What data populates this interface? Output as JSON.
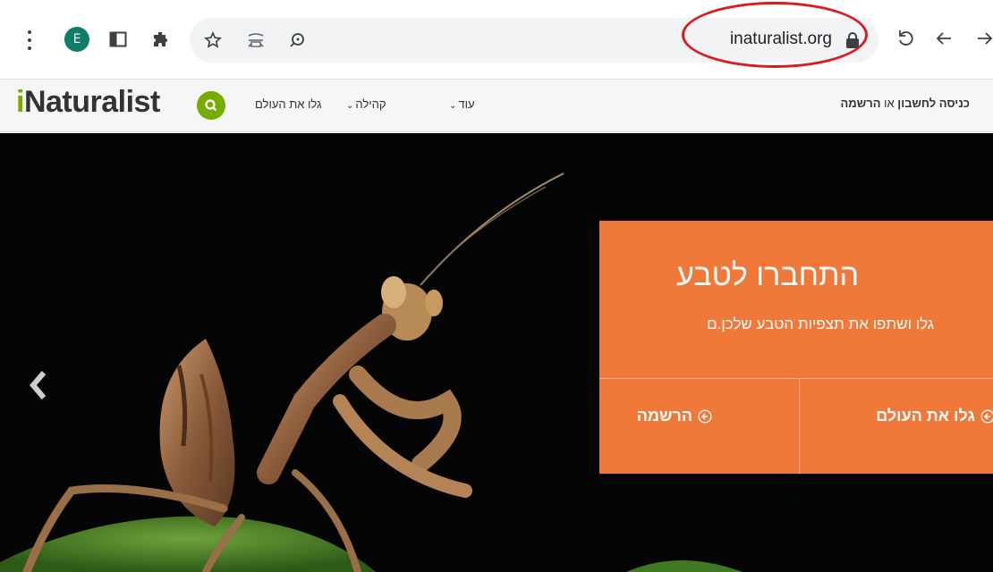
{
  "browser": {
    "profile_initial": "E",
    "url": "inaturalist.org",
    "icons": [
      "menu-icon",
      "sidebar-icon",
      "extensions-icon",
      "star-icon",
      "cast-icon",
      "lens-icon",
      "lock-icon",
      "reload-icon",
      "back-icon",
      "forward-icon"
    ]
  },
  "header": {
    "logo_prefix": "i",
    "logo_rest": "Naturalist",
    "nav": {
      "explore": "גלו את העולם",
      "community": "קהילה",
      "more": "עוד"
    },
    "login": "כניסה לחשבון",
    "or": "או",
    "signup": "הרשמה"
  },
  "hero": {
    "title": "התחברו לטבע",
    "subtitle": "גלו ושתפו את תצפיות הטבע שלכן.ם",
    "signup_button": "הרשמה",
    "explore_button": "גלו את העולם",
    "accent_color": "#f0793a"
  },
  "colors": {
    "brand_green": "#74ac00",
    "annotation_red": "#d91c1c"
  }
}
